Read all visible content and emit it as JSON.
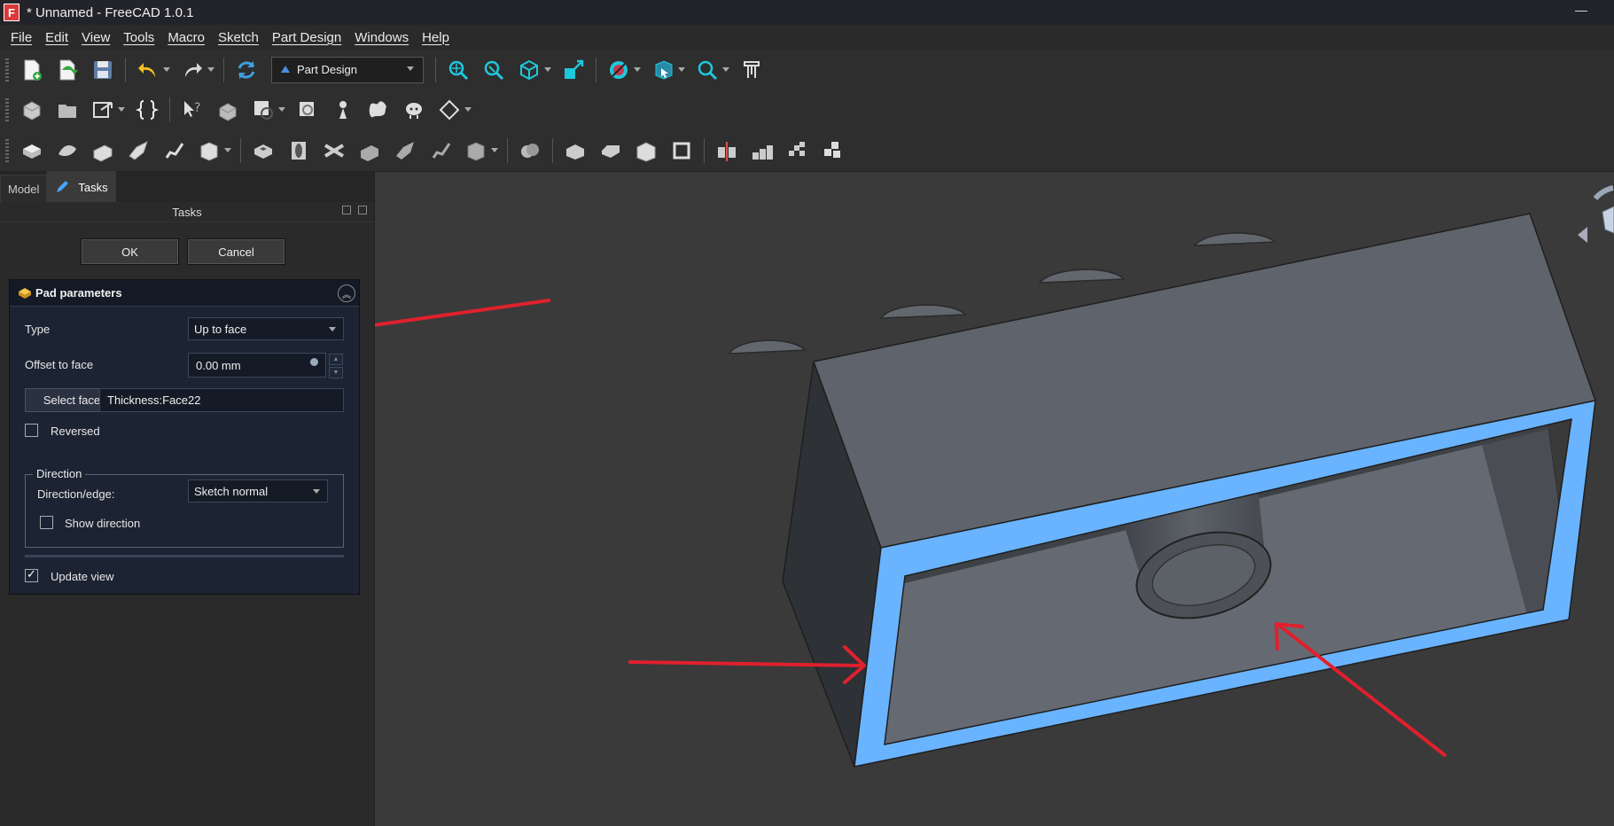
{
  "window": {
    "title": "* Unnamed - FreeCAD 1.0.1",
    "logo_letter": "F",
    "minimize": "—"
  },
  "menu": [
    "File",
    "Edit",
    "View",
    "Tools",
    "Macro",
    "Sketch",
    "Part Design",
    "Windows",
    "Help"
  ],
  "toolbar": {
    "workbench": "Part Design"
  },
  "left_panel": {
    "tabs": [
      {
        "label": "Model"
      },
      {
        "label": "Tasks"
      }
    ],
    "tasks_title": "Tasks",
    "ok_label": "OK",
    "cancel_label": "Cancel",
    "pad": {
      "title": "Pad parameters",
      "type_label": "Type",
      "type_value": "Up to face",
      "offset_label": "Offset to face",
      "offset_value": "0.00 mm",
      "select_face_label": "Select face",
      "face_value": "Thickness:Face22",
      "reversed_label": "Reversed",
      "reversed_checked": false,
      "direction_group": "Direction",
      "direction_edge_label": "Direction/edge:",
      "direction_value": "Sketch normal",
      "show_direction_label": "Show direction",
      "show_direction_checked": false,
      "update_view_label": "Update view",
      "update_view_checked": true
    }
  },
  "colors": {
    "face_highlight": "#6ab4ff",
    "annotation_arrow": "#e0202e",
    "model_gray": "#5f646c"
  }
}
